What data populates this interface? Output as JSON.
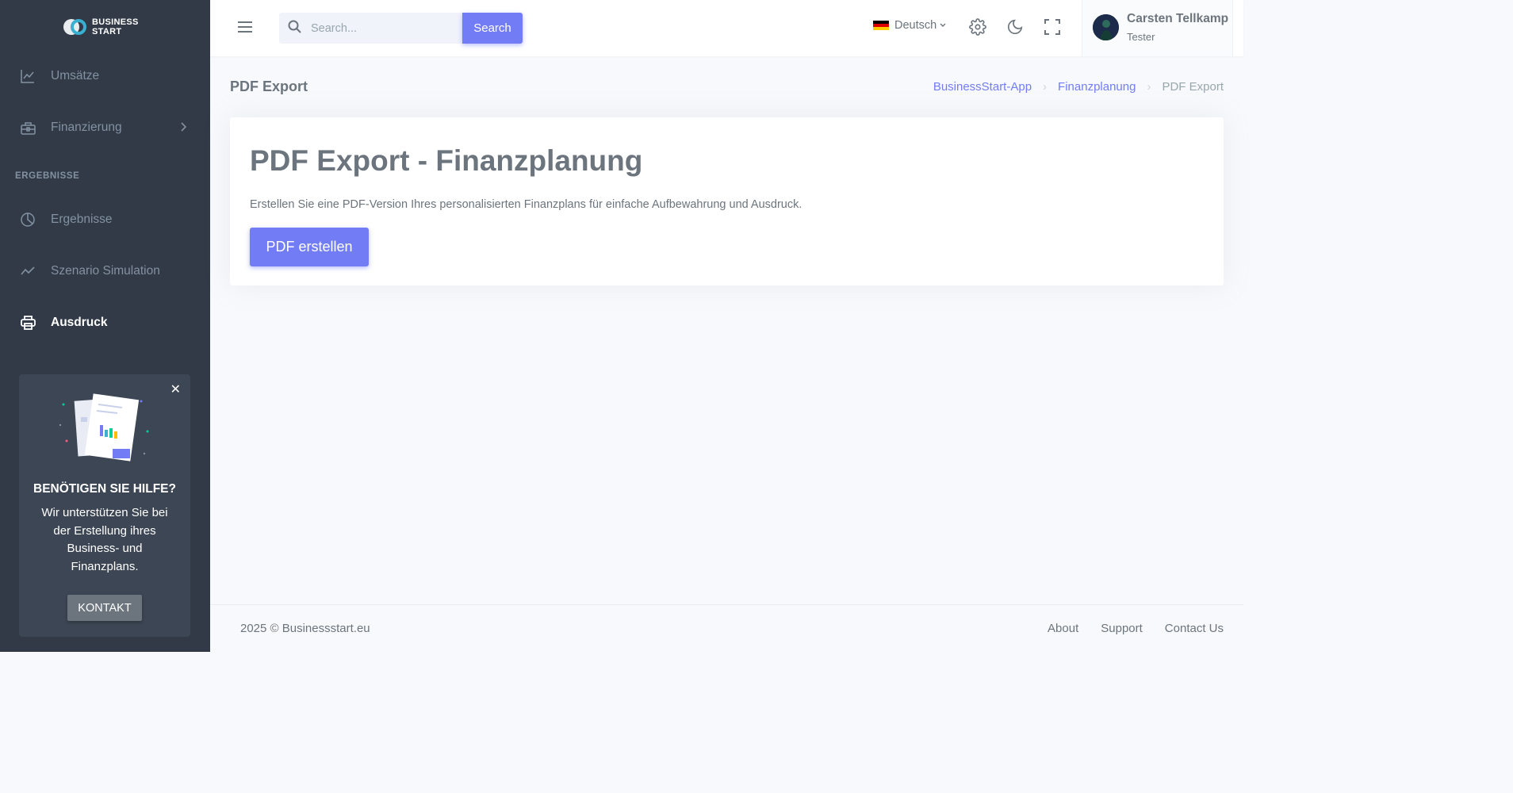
{
  "brand": {
    "line1": "BUSINESS",
    "line2": "START"
  },
  "sidebar": {
    "items": [
      {
        "label": "Umsätze",
        "icon": "line-chart-icon"
      },
      {
        "label": "Finanzierung",
        "icon": "briefcase-icon"
      }
    ],
    "section_title": "ERGEBNISSE",
    "results_items": [
      {
        "label": "Ergebnisse",
        "icon": "pie-chart-icon"
      },
      {
        "label": "Szenario Simulation",
        "icon": "trend-icon"
      },
      {
        "label": "Ausdruck",
        "icon": "printer-icon",
        "active": true
      }
    ],
    "help": {
      "title": "BENÖTIGEN SIE HILFE?",
      "text": "Wir unterstützen Sie bei der Erstellung ihres Business- und Finanzplans.",
      "button": "KONTAKT"
    }
  },
  "topbar": {
    "search_placeholder": "Search...",
    "search_button": "Search",
    "language": "Deutsch",
    "user_name": "Carsten Tellkamp",
    "user_role": "Tester"
  },
  "page": {
    "title": "PDF Export",
    "breadcrumb": [
      "BusinessStart-App",
      "Finanzplanung",
      "PDF Export"
    ]
  },
  "card": {
    "title": "PDF Export - Finanzplanung",
    "description": "Erstellen Sie eine PDF-Version Ihres personalisierten Finanzplans für einfache Aufbewahrung und Ausdruck.",
    "button": "PDF erstellen"
  },
  "footer": {
    "copyright": "2025 © Businessstart.eu",
    "links": [
      "About",
      "Support",
      "Contact Us"
    ]
  },
  "colors": {
    "primary": "#727cf5",
    "sidebar_bg": "#313a46",
    "accent": "#39afd1"
  }
}
